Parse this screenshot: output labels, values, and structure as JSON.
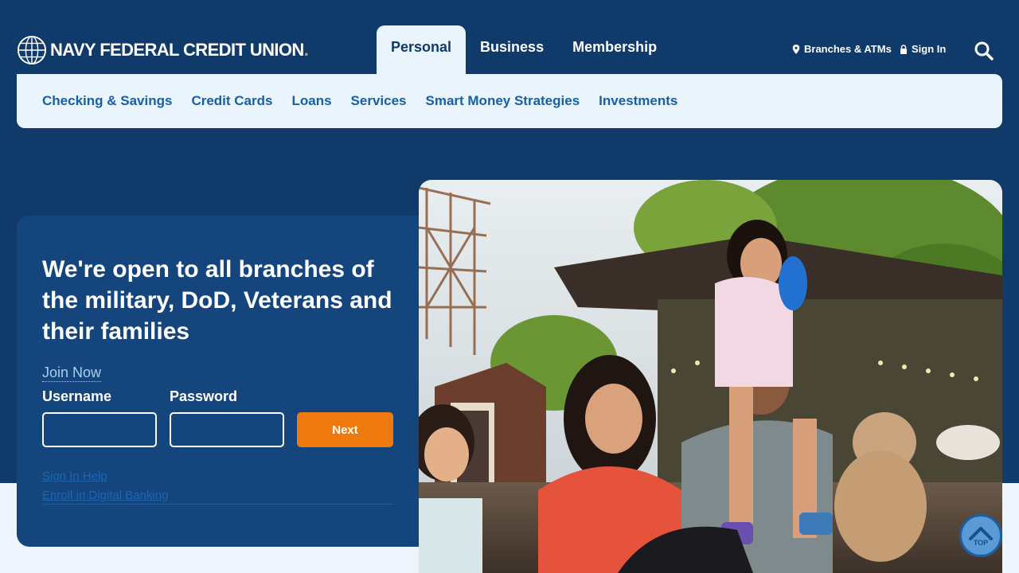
{
  "header": {
    "logo_text": "NAVY FEDERAL CREDIT UNION",
    "logo_dot": ".",
    "tabs": [
      {
        "label": "Personal",
        "active": true
      },
      {
        "label": "Business",
        "active": false
      },
      {
        "label": "Membership",
        "active": false
      }
    ],
    "branches_label": "Branches & ATMs",
    "signin_label": "Sign In",
    "icons": {
      "logo": "globe-icon",
      "branches": "map-pin-icon",
      "signin": "lock-icon",
      "search": "search-icon"
    }
  },
  "subnav": {
    "items": [
      "Checking & Savings",
      "Credit Cards",
      "Loans",
      "Services",
      "Smart Money Strategies",
      "Investments"
    ]
  },
  "login": {
    "heading": "We're open to all branches of the military, DoD, Veterans and their families",
    "join_label": "Join Now",
    "username_label": "Username",
    "username_value": "",
    "password_label": "Password",
    "password_value": "",
    "next_label": "Next",
    "links": [
      "Sign In Help",
      "Enroll in Digital Banking"
    ]
  },
  "hero": {
    "icon": "family-photo"
  },
  "back_to_top": {
    "label": "TOP",
    "icon": "chevron-up-icon"
  },
  "colors": {
    "navy": "#0f3a6a",
    "card": "#14457d",
    "accent_orange": "#ee7a0e",
    "link_blue": "#1560a8",
    "light_bg": "#eaf4fd"
  }
}
